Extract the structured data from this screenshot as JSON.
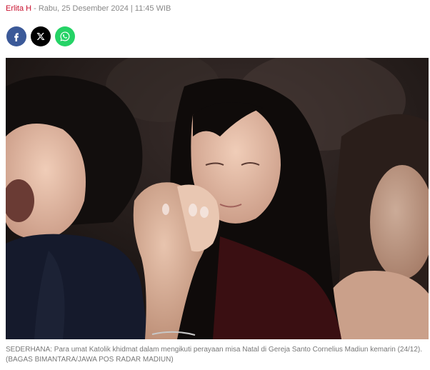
{
  "article_meta": {
    "author": "Erlita H",
    "separator": "-",
    "date": "Rabu, 25 Desember 2024 | 11:45 WIB"
  },
  "share": [
    {
      "name": "facebook",
      "icon": "facebook-icon",
      "color": "#3b5998"
    },
    {
      "name": "x",
      "icon": "x-icon",
      "color": "#000000"
    },
    {
      "name": "whatsapp",
      "icon": "whatsapp-icon",
      "color": "#25d366"
    }
  ],
  "photo": {
    "caption": "SEDERHANA: Para umat Katolik khidmat dalam mengikuti perayaan misa Natal di Gereja Santo Cornelius Madiun kemarin (24/12). (BAGAS BIMANTARA/JAWA POS RADAR MADIUN)"
  },
  "colors": {
    "author": "#c8102e",
    "meta_text": "#888888",
    "caption_text": "#777777"
  }
}
